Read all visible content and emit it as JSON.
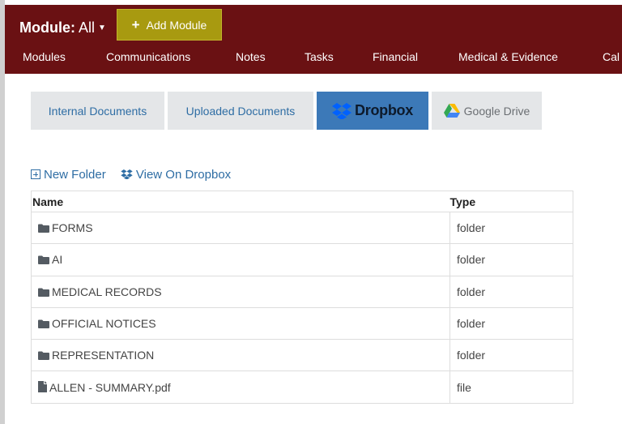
{
  "header": {
    "module_key": "Module:",
    "module_value": "All",
    "add_module_label": "Add Module",
    "colors": {
      "bar": "#6a1113",
      "add_button": "#a89a10"
    }
  },
  "nav": {
    "items": [
      "Modules",
      "Communications",
      "Notes",
      "Tasks",
      "Financial",
      "Medical & Evidence",
      "Cal"
    ]
  },
  "tabs": [
    {
      "label": "Internal Documents",
      "active": false
    },
    {
      "label": "Uploaded Documents",
      "active": false
    },
    {
      "label": "Dropbox",
      "active": true,
      "icon": "dropbox-icon"
    },
    {
      "label": "Google Drive",
      "active": false,
      "icon": "google-drive-icon"
    }
  ],
  "actions": {
    "new_folder": "New Folder",
    "view_on_dropbox": "View On Dropbox"
  },
  "table": {
    "columns": [
      "Name",
      "Type"
    ],
    "rows": [
      {
        "name": "FORMS",
        "type": "folder",
        "icon": "folder-icon"
      },
      {
        "name": "AI",
        "type": "folder",
        "icon": "folder-icon"
      },
      {
        "name": "MEDICAL RECORDS",
        "type": "folder",
        "icon": "folder-icon"
      },
      {
        "name": "OFFICIAL NOTICES",
        "type": "folder",
        "icon": "folder-icon"
      },
      {
        "name": "REPRESENTATION",
        "type": "folder",
        "icon": "folder-icon"
      },
      {
        "name": "ALLEN - SUMMARY.pdf",
        "type": "file",
        "icon": "file-icon"
      }
    ]
  }
}
